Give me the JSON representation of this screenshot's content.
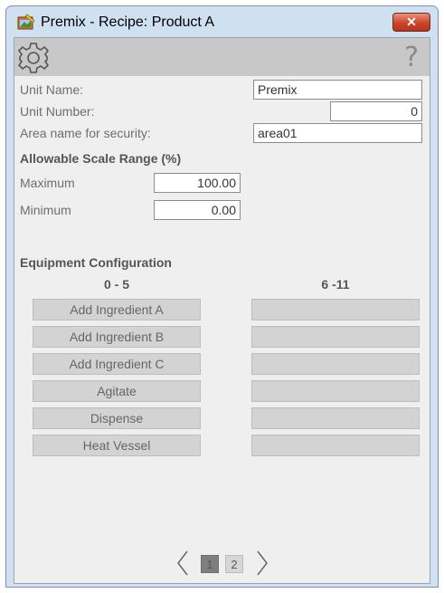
{
  "window": {
    "title": "Premix - Recipe: Product A",
    "close_label": "✕"
  },
  "toolbar": {
    "settings_icon": "gear-icon",
    "help_label": "?"
  },
  "unit": {
    "name_label": "Unit Name:",
    "name_value": "Premix",
    "number_label": "Unit Number:",
    "number_value": "0",
    "area_label": "Area name for security:",
    "area_value": "area01"
  },
  "scale": {
    "header": "Allowable Scale Range (%)",
    "max_label": "Maximum",
    "max_value": "100.00",
    "min_label": "Minimum",
    "min_value": "0.00"
  },
  "equipment": {
    "header": "Equipment Configuration",
    "col_left": "0 - 5",
    "col_right": "6 -11",
    "left": [
      "Add Ingredient A",
      "Add Ingredient B",
      "Add Ingredient C",
      "Agitate",
      "Dispense",
      "Heat Vessel"
    ],
    "right": [
      "",
      "",
      "",
      "",
      "",
      ""
    ]
  },
  "pager": {
    "pages": [
      "1",
      "2"
    ],
    "current": 1
  },
  "colors": {
    "title_bar": "#cfe0f1",
    "close_button": "#c9452b",
    "toolbar": "#c8c8c8",
    "active_page": "#7f7f7f"
  }
}
